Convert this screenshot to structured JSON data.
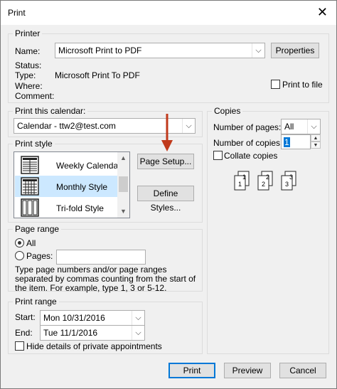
{
  "window": {
    "title": "Print",
    "close_glyph": "✕"
  },
  "printer": {
    "group_label": "Printer",
    "name_label": "Name:",
    "name_value": "Microsoft Print to PDF",
    "properties_button": "Properties",
    "status_label": "Status:",
    "type_label": "Type:",
    "type_value": "Microsoft Print To PDF",
    "where_label": "Where:",
    "comment_label": "Comment:",
    "print_to_file_label": "Print to file"
  },
  "calendar": {
    "group_label": "Print this calendar:",
    "value": "Calendar - ttw2@test.com"
  },
  "print_style": {
    "group_label": "Print style",
    "items": [
      {
        "label": "Weekly Calendar S",
        "icon": "weekly-calendar-icon"
      },
      {
        "label": "Monthly Style",
        "icon": "monthly-calendar-icon",
        "selected": true
      },
      {
        "label": "Tri-fold Style",
        "icon": "trifold-calendar-icon"
      }
    ],
    "page_setup_button": "Page Setup...",
    "define_styles_button": "Define Styles..."
  },
  "page_range": {
    "group_label": "Page range",
    "all_label": "All",
    "pages_label": "Pages:",
    "pages_value": "",
    "help_text": "Type page numbers and/or page ranges separated by commas counting from the start of the item.  For example, type 1, 3 or 5-12."
  },
  "print_range": {
    "group_label": "Print range",
    "start_label": "Start:",
    "start_value": "Mon 10/31/2016",
    "end_label": "End:",
    "end_value": "Tue 11/1/2016",
    "hide_private_label": "Hide details of private appointments"
  },
  "copies": {
    "group_label": "Copies",
    "num_pages_label": "Number of pages:",
    "num_pages_value": "All",
    "num_copies_label": "Number of copies:",
    "num_copies_value": "1",
    "collate_label": "Collate copies",
    "collate_illustration": [
      "1",
      "1",
      "2",
      "2",
      "3",
      "3"
    ]
  },
  "footer": {
    "print_button": "Print",
    "preview_button": "Preview",
    "cancel_button": "Cancel"
  },
  "annotation": {
    "arrow_color": "#c0391b"
  }
}
